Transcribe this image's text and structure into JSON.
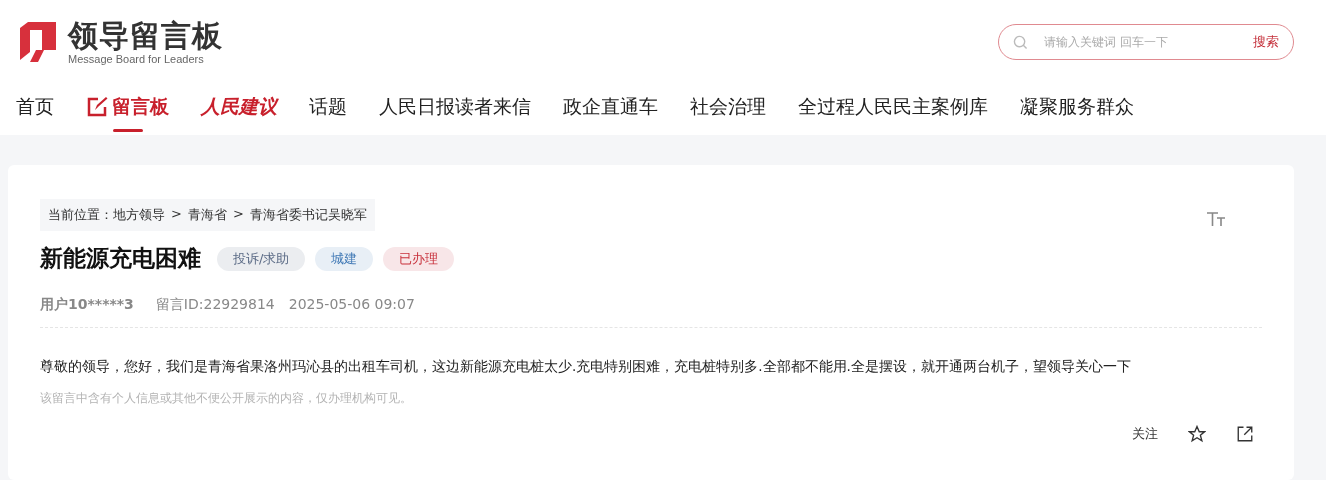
{
  "logo": {
    "title": "领导留言板",
    "subtitle": "Message Board for Leaders"
  },
  "search": {
    "placeholder": "请输入关键词 回车一下",
    "button": "搜索"
  },
  "nav": [
    {
      "label": "首页",
      "kind": "plain",
      "selected": false
    },
    {
      "label": "留言板",
      "kind": "board",
      "selected": true
    },
    {
      "label": "人民建议",
      "kind": "brand",
      "selected": false
    },
    {
      "label": "话题",
      "kind": "plain",
      "selected": false
    },
    {
      "label": "人民日报读者来信",
      "kind": "plain",
      "selected": false
    },
    {
      "label": "政企直通车",
      "kind": "plain",
      "selected": false
    },
    {
      "label": "社会治理",
      "kind": "plain",
      "selected": false
    },
    {
      "label": "全过程人民民主案例库",
      "kind": "plain",
      "selected": false
    },
    {
      "label": "凝聚服务群众",
      "kind": "plain",
      "selected": false
    }
  ],
  "breadcrumb": {
    "prefix": "当前位置：",
    "items": [
      "地方领导",
      "青海省",
      "青海省委书记吴晓军"
    ],
    "separator": ">"
  },
  "message": {
    "title": "新能源充电困难",
    "tags": [
      {
        "label": "投诉/求助",
        "color": "#5b6b86"
      },
      {
        "label": "城建",
        "color": "#3f78b5"
      },
      {
        "label": "已办理",
        "color": "#c8313c"
      }
    ],
    "author": "用户10*****3",
    "id": "留言ID:22929814",
    "time": "2025-05-06 09:07",
    "body": "尊敬的领导，您好，我们是青海省果洛州玛沁县的出租车司机，这边新能源充电桩太少.充电特别困难，充电桩特别多.全部都不能用.全是摆设，就开通两台机子，望领导关心一下",
    "notice": "该留言中含有个人信息或其他不便公开展示的内容，仅办理机构可见。",
    "actions": {
      "follow": "关注"
    }
  }
}
